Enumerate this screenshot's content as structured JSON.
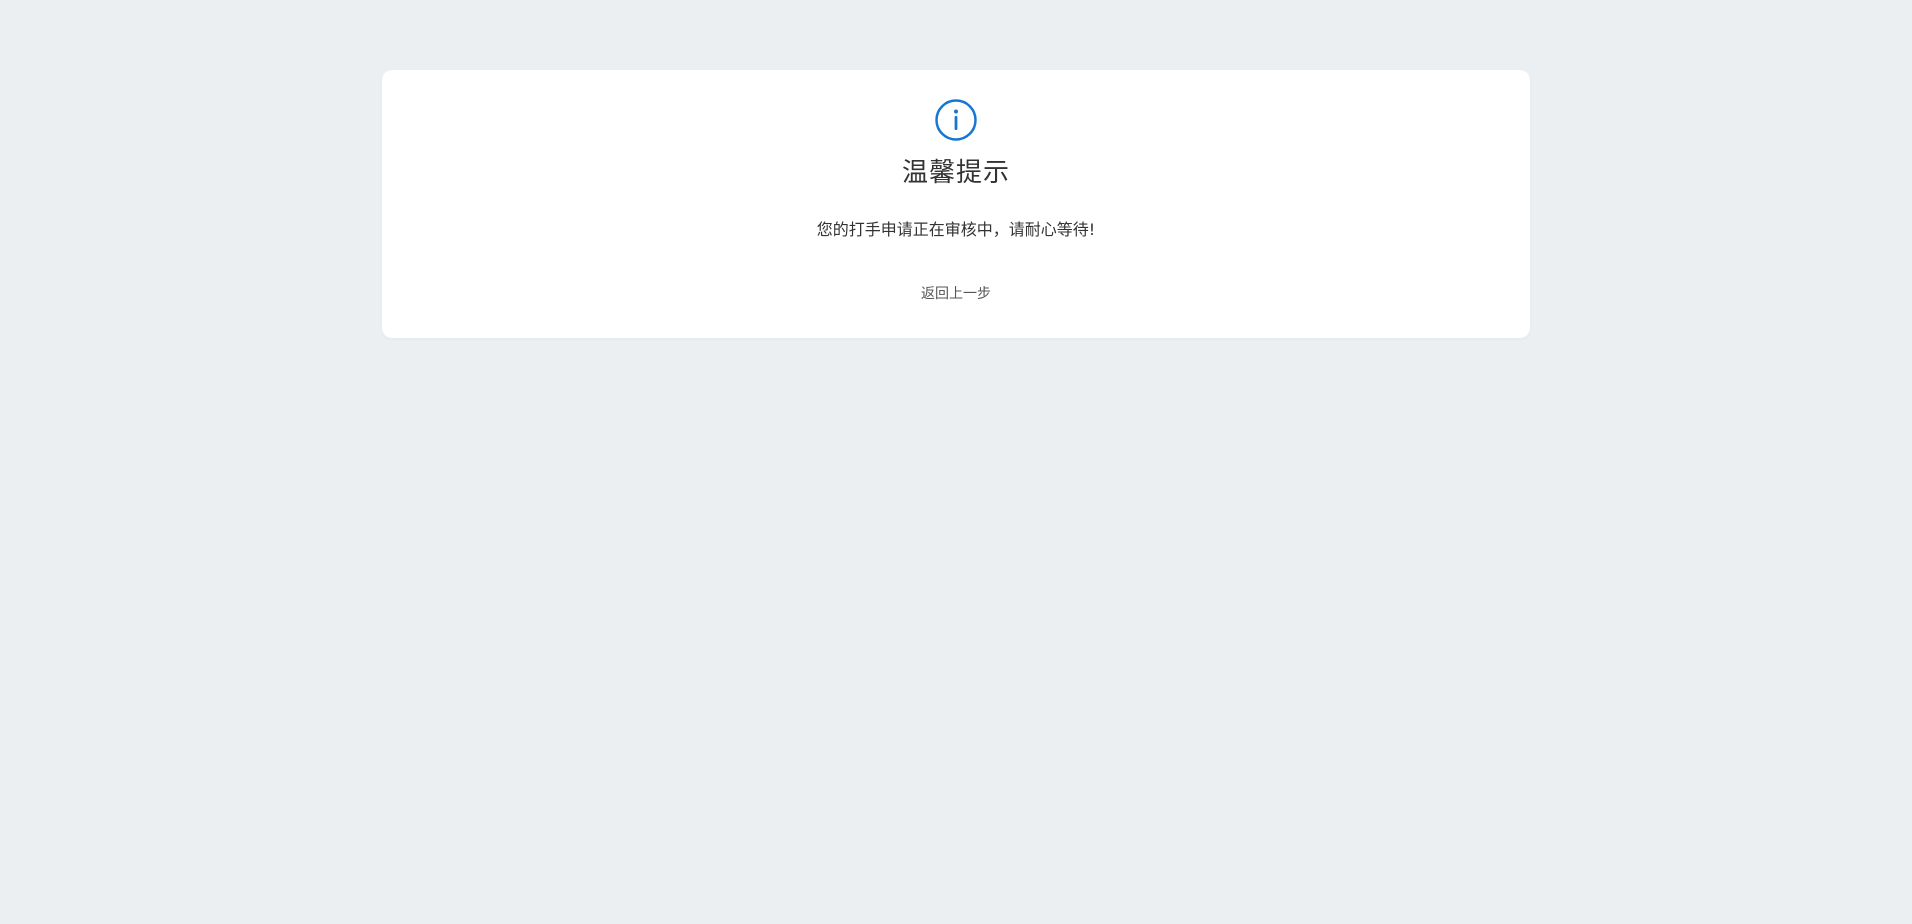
{
  "dialog": {
    "icon": "info-circle-icon",
    "icon_color": "#1677d2",
    "title": "温馨提示",
    "message": "您的打手申请正在审核中，请耐心等待!",
    "back_label": "返回上一步"
  },
  "colors": {
    "background": "#eceff2",
    "card": "#ffffff",
    "text": "#333333"
  }
}
